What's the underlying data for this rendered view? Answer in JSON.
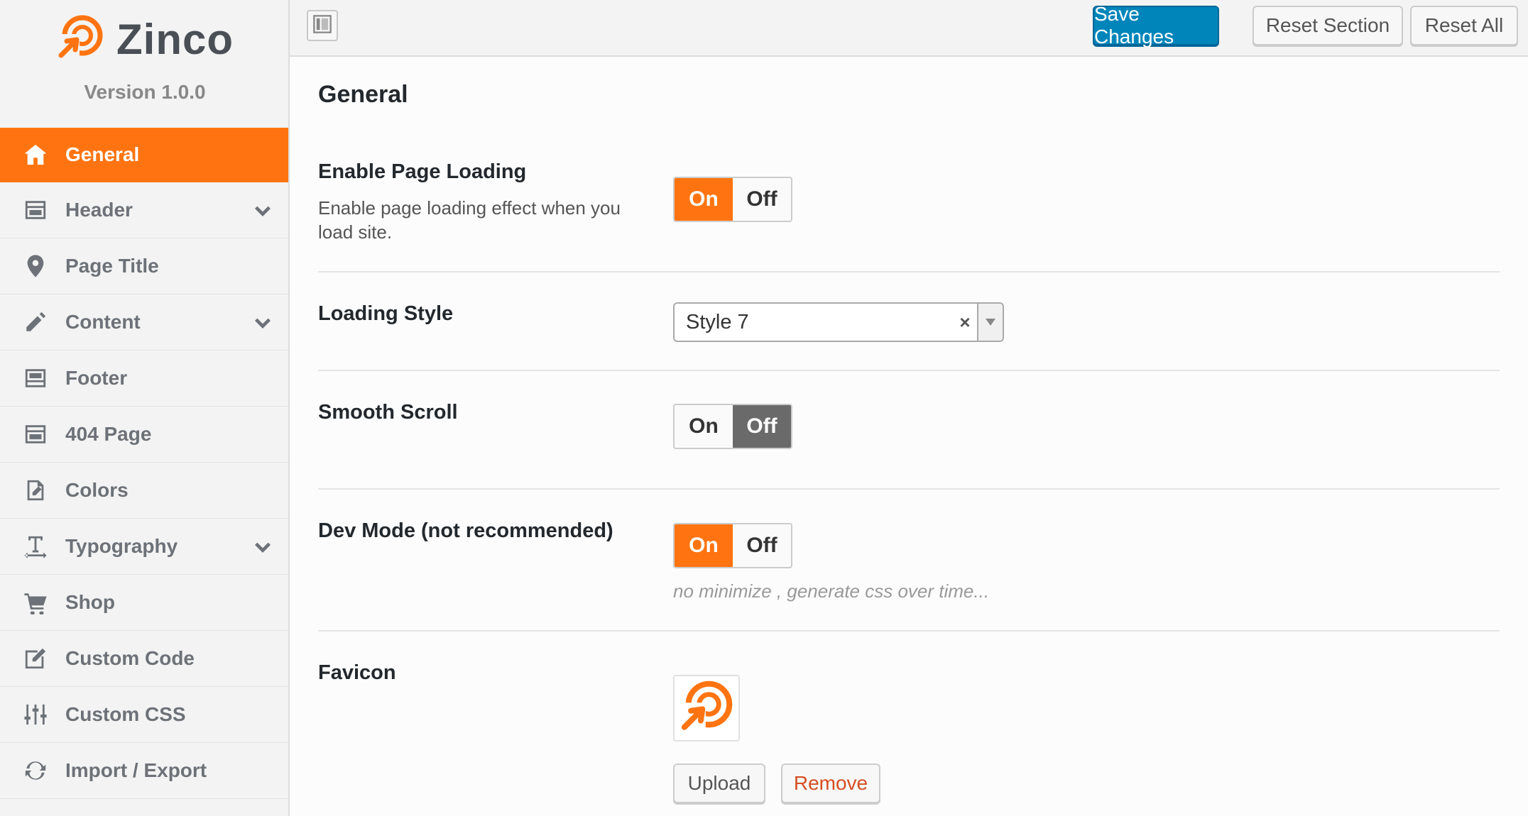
{
  "brand": {
    "name": "Zinco",
    "version": "Version 1.0.0",
    "logo_icon": "zinco-logo-icon",
    "accent": "#ff7410"
  },
  "sidebar": {
    "items": [
      {
        "label": "General",
        "icon": "home-icon",
        "active": true
      },
      {
        "label": "Header",
        "icon": "layout-icon",
        "expandable": true
      },
      {
        "label": "Page Title",
        "icon": "map-pin-icon"
      },
      {
        "label": "Content",
        "icon": "pencil-icon",
        "expandable": true
      },
      {
        "label": "Footer",
        "icon": "layout-icon"
      },
      {
        "label": "404 Page",
        "icon": "layout-icon"
      },
      {
        "label": "Colors",
        "icon": "edit-page-icon"
      },
      {
        "label": "Typography",
        "icon": "text-cursor-icon",
        "expandable": true
      },
      {
        "label": "Shop",
        "icon": "cart-icon"
      },
      {
        "label": "Custom Code",
        "icon": "edit-square-icon"
      },
      {
        "label": "Custom CSS",
        "icon": "sliders-icon"
      },
      {
        "label": "Import / Export",
        "icon": "refresh-icon"
      }
    ]
  },
  "toolbar": {
    "save_label": "Save Changes",
    "reset_section_label": "Reset Section",
    "reset_all_label": "Reset All",
    "primary_color": "#0085ba"
  },
  "main": {
    "section_title": "General",
    "fields": {
      "page_loading": {
        "label": "Enable Page Loading",
        "description": "Enable page loading effect when you load site.",
        "on": "On",
        "off": "Off",
        "value": "On"
      },
      "loading_style": {
        "label": "Loading Style",
        "value": "Style 7",
        "clear": "×"
      },
      "smooth_scroll": {
        "label": "Smooth Scroll",
        "on": "On",
        "off": "Off",
        "value": "Off"
      },
      "dev_mode": {
        "label": "Dev Mode (not recommended)",
        "on": "On",
        "off": "Off",
        "value": "On",
        "hint": "no minimize , generate css over time..."
      },
      "favicon": {
        "label": "Favicon",
        "upload_label": "Upload",
        "remove_label": "Remove"
      }
    }
  }
}
